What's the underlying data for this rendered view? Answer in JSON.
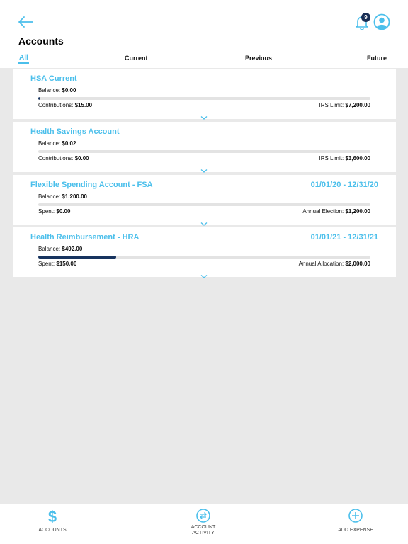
{
  "header": {
    "title": "Accounts",
    "notification_count": "9",
    "back_icon": "arrow-left-icon",
    "bell_icon": "bell-icon",
    "avatar_icon": "user-avatar-icon"
  },
  "tabs": [
    {
      "label": "All",
      "active": true
    },
    {
      "label": "Current"
    },
    {
      "label": "Previous"
    },
    {
      "label": "Future"
    }
  ],
  "accounts": [
    {
      "title": "HSA Current",
      "dates": "",
      "balance_label": "Balance:",
      "balance": "$0.00",
      "progress": 0.003,
      "left_label": "Contributions:",
      "left_value": "$15.00",
      "right_label": "IRS Limit:",
      "right_value": "$7,200.00"
    },
    {
      "title": "Health Savings Account",
      "dates": "",
      "balance_label": "Balance:",
      "balance": "$0.02",
      "progress": 0,
      "left_label": "Contributions:",
      "left_value": "$0.00",
      "right_label": "IRS Limit:",
      "right_value": "$3,600.00"
    },
    {
      "title": "Flexible Spending Account - FSA",
      "dates": "01/01/20 - 12/31/20",
      "balance_label": "Balance:",
      "balance": "$1,200.00",
      "progress": 0,
      "left_label": "Spent:",
      "left_value": "$0.00",
      "right_label": "Annual Election:",
      "right_value": "$1,200.00"
    },
    {
      "title": "Health Reimbursement - HRA",
      "dates": "01/01/21 - 12/31/21",
      "balance_label": "Balance:",
      "balance": "$492.00",
      "progress": 0.235,
      "left_label": "Spent:",
      "left_value": "$150.00",
      "right_label": "Annual Allocation:",
      "right_value": "$2,000.00"
    }
  ],
  "bottom_nav": [
    {
      "label": "ACCOUNTS",
      "icon": "dollar-icon"
    },
    {
      "label": "ACCOUNT ACTIVITY",
      "label_line1": "ACCOUNT",
      "label_line2": "ACTIVITY",
      "icon": "transfer-arrows-icon"
    },
    {
      "label": "ADD EXPENSE",
      "icon": "plus-circle-icon"
    }
  ],
  "colors": {
    "accent": "#4bbfeb",
    "progress_fill": "#17345f",
    "progress_track": "#e3e3e3",
    "background": "#e9e9e9",
    "badge": "#1a2f55"
  }
}
